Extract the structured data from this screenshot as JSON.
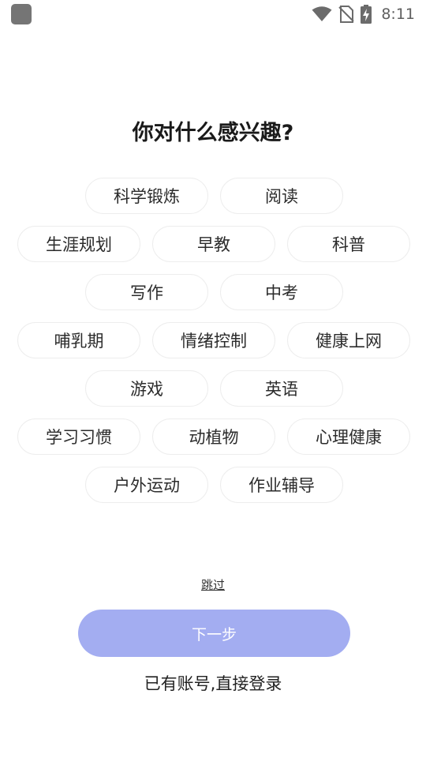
{
  "status_bar": {
    "time": "8:11",
    "icons": [
      "wifi-icon",
      "no-sim-icon",
      "battery-charging-icon"
    ]
  },
  "title": "你对什么感兴趣?",
  "interests": [
    "科学锻炼",
    "阅读",
    "生涯规划",
    "早教",
    "科普",
    "写作",
    "中考",
    "哺乳期",
    "情绪控制",
    "健康上网",
    "游戏",
    "英语",
    "学习习惯",
    "动植物",
    "心理健康",
    "户外运动",
    "作业辅导"
  ],
  "skip_label": "跳过",
  "next_label": "下一步",
  "login_label": "已有账号,直接登录",
  "colors": {
    "primary_button": "#a3adf1",
    "chip_border": "#ededed"
  }
}
